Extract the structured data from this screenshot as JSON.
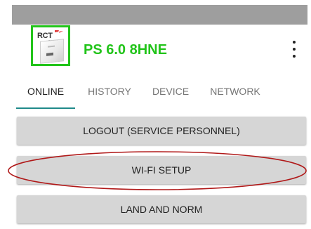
{
  "app_bar": {
    "logo": {
      "brand_text": "RCT",
      "sub_text": "power"
    },
    "title": "PS 6.0 8HNE",
    "overflow_icon": "more-vert-icon"
  },
  "tabs": [
    {
      "label": "ONLINE",
      "active": true
    },
    {
      "label": "HISTORY",
      "active": false
    },
    {
      "label": "DEVICE",
      "active": false
    },
    {
      "label": "NETWORK",
      "active": false
    }
  ],
  "buttons": [
    {
      "label": "LOGOUT (SERVICE PERSONNEL)"
    },
    {
      "label": "WI-FI SETUP",
      "highlighted": true
    },
    {
      "label": "LAND AND NORM"
    }
  ],
  "colors": {
    "status_bar": "#9e9e9e",
    "title_green": "#22c41a",
    "tab_indicator": "#1f8a8a",
    "button_bg": "#d6d6d6",
    "highlight_ellipse": "#b01818"
  }
}
